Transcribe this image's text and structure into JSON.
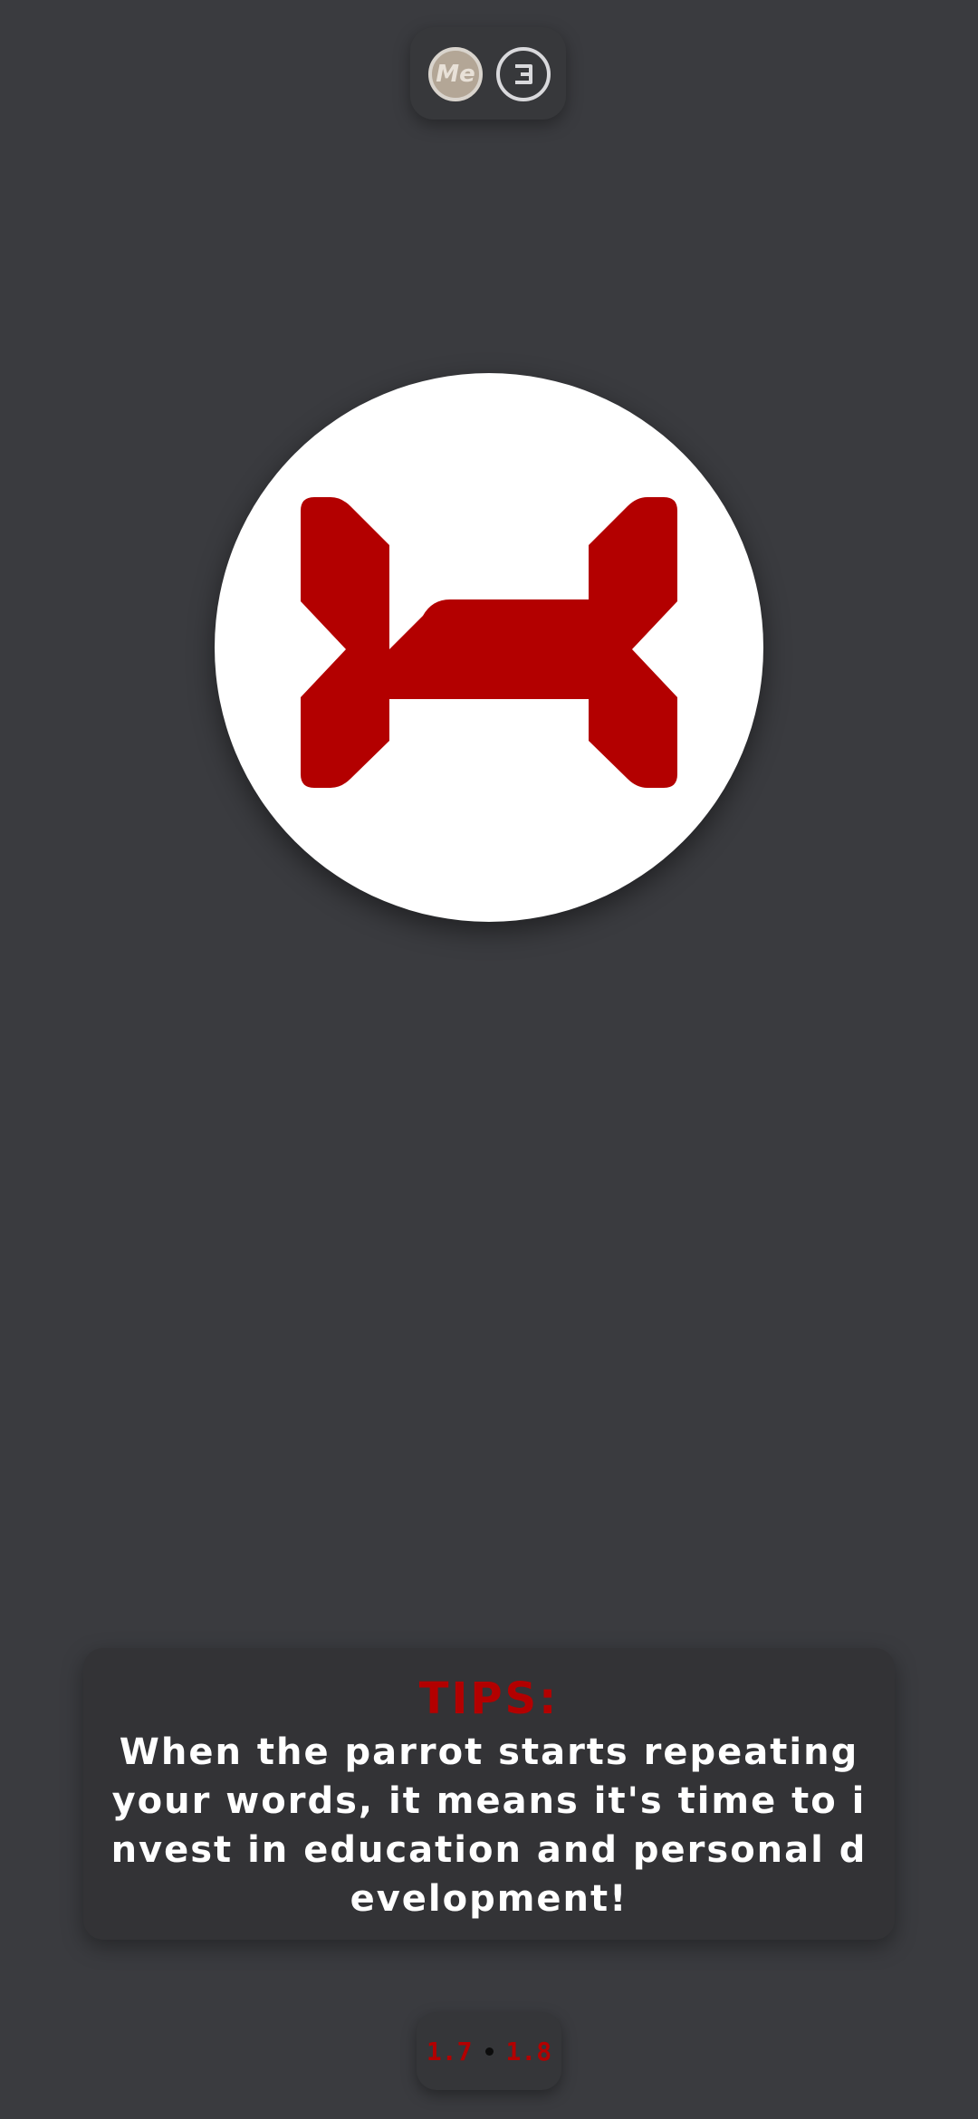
{
  "header": {
    "avatar_label": "Me",
    "logo_icon": "e-logo-icon"
  },
  "main": {
    "emblem_icon": "dog-bone-icon",
    "emblem_color": "#b30000"
  },
  "tips": {
    "title": "TIPS:",
    "text": "When the parrot starts repeating your words, it means it's time to invest in education and personal development!"
  },
  "pager": {
    "current": "1.7",
    "next": "1.8"
  },
  "colors": {
    "background": "#3a3b3f",
    "accent": "#b30000",
    "panel": "#333336"
  }
}
